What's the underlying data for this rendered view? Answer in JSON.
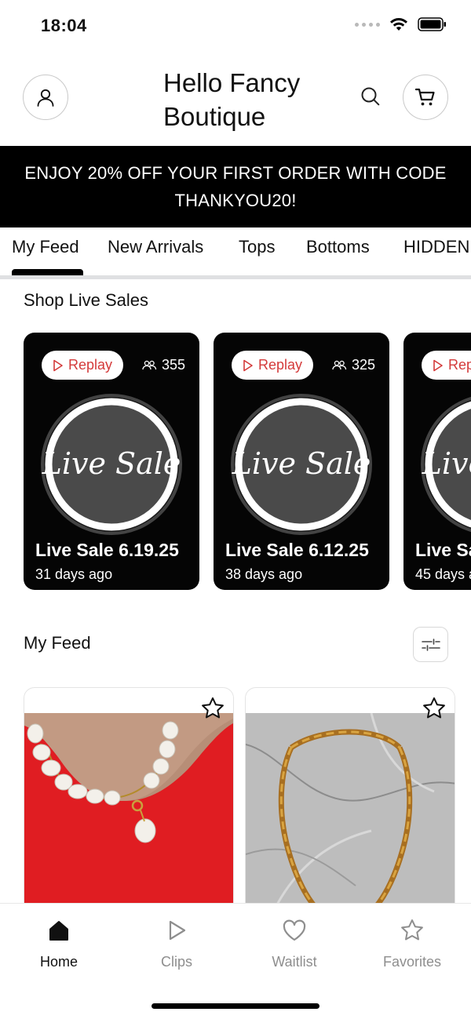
{
  "status_bar": {
    "time": "18:04"
  },
  "header": {
    "store_name": "Hello Fancy Boutique"
  },
  "promo": {
    "text": "ENJOY 20% OFF YOUR FIRST ORDER WITH CODE THANKYOU20!"
  },
  "tabs": [
    {
      "label": "My Feed",
      "active": true
    },
    {
      "label": "New Arrivals"
    },
    {
      "label": "Tops"
    },
    {
      "label": "Bottoms"
    },
    {
      "label": "HIDDEN"
    }
  ],
  "live_sales": {
    "title": "Shop Live Sales",
    "replay_label": "Replay",
    "logo_text": "Live Sale",
    "cards": [
      {
        "title": "Live Sale 6.19.25",
        "ago": "31 days ago",
        "viewers": "355"
      },
      {
        "title": "Live Sale 6.12.25",
        "ago": "38 days ago",
        "viewers": "325"
      },
      {
        "title": "Live Sa",
        "ago": "45 days a",
        "viewers": ""
      }
    ]
  },
  "feed": {
    "title": "My Feed"
  },
  "bottom_nav": [
    {
      "label": "Home",
      "icon": "home-icon",
      "active": true
    },
    {
      "label": "Clips",
      "icon": "play-icon"
    },
    {
      "label": "Waitlist",
      "icon": "heart-icon"
    },
    {
      "label": "Favorites",
      "icon": "star-icon"
    }
  ],
  "colors": {
    "accent_red": "#d43a3a",
    "banner_bg": "#000000",
    "tab_divider": "#dfe0e2"
  }
}
